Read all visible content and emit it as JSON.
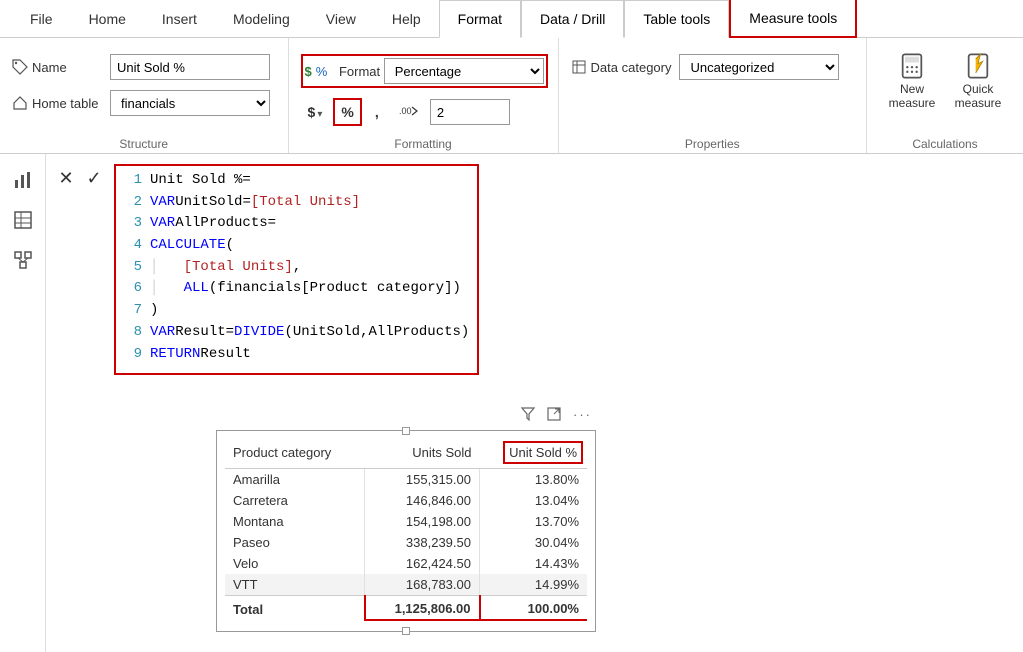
{
  "tabs": {
    "file": "File",
    "home": "Home",
    "insert": "Insert",
    "modeling": "Modeling",
    "view": "View",
    "help": "Help",
    "format": "Format",
    "data_drill": "Data / Drill",
    "table_tools": "Table tools",
    "measure_tools": "Measure tools"
  },
  "structure": {
    "name_label": "Name",
    "name_value": "Unit Sold %",
    "home_table_label": "Home table",
    "home_table_value": "financials",
    "group": "Structure"
  },
  "formatting": {
    "format_label": "Format",
    "format_value": "Percentage",
    "currency": "$",
    "percent": "%",
    "comma": ",",
    "decimals_value": "2",
    "group": "Formatting"
  },
  "properties": {
    "data_category_label": "Data category",
    "data_category_value": "Uncategorized",
    "group": "Properties"
  },
  "calculations": {
    "new_measure": "New measure",
    "quick_measure": "Quick measure",
    "group": "Calculations"
  },
  "formula": {
    "l1a": "Unit Sold % ",
    "l1b": "=",
    "l2a": "VAR",
    "l2b": " UnitSold ",
    "l2c": "=",
    "l2d": " [Total Units]",
    "l3a": "VAR",
    "l3b": " AllProducts ",
    "l3c": "=",
    "l4a": "CALCULATE",
    "l4b": " (",
    "l5a": "[Total Units]",
    "l5b": ",",
    "l6a": "ALL",
    "l6b": " (financials[Product category])",
    "l7": ")",
    "l8a": "VAR",
    "l8b": " Result ",
    "l8c": "=",
    "l8d": " DIVIDE",
    "l8e": " ( ",
    "l8f": "UnitSold",
    "l8g": ", ",
    "l8h": "AllProducts",
    "l8i": " )",
    "l9a": "RETURN",
    "l9b": " Result"
  },
  "table": {
    "headers": {
      "category": "Product category",
      "units": "Units Sold",
      "pct": "Unit Sold %"
    },
    "rows": [
      {
        "category": "Amarilla",
        "units": "155,315.00",
        "pct": "13.80%"
      },
      {
        "category": "Carretera",
        "units": "146,846.00",
        "pct": "13.04%"
      },
      {
        "category": "Montana",
        "units": "154,198.00",
        "pct": "13.70%"
      },
      {
        "category": "Paseo",
        "units": "338,239.50",
        "pct": "30.04%"
      },
      {
        "category": "Velo",
        "units": "162,424.50",
        "pct": "14.43%"
      },
      {
        "category": "VTT",
        "units": "168,783.00",
        "pct": "14.99%"
      }
    ],
    "total": {
      "label": "Total",
      "units": "1,125,806.00",
      "pct": "100.00%"
    }
  },
  "line_nums": [
    "1",
    "2",
    "3",
    "4",
    "5",
    "6",
    "7",
    "8",
    "9"
  ]
}
